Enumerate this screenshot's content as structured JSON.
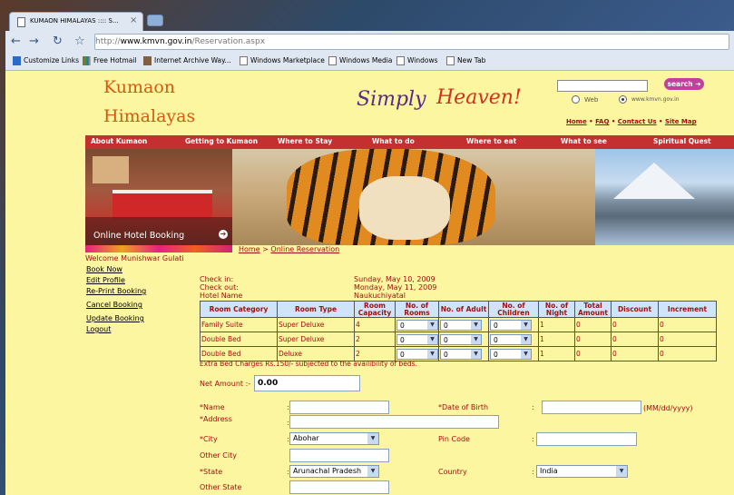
{
  "browser": {
    "tab_title": "KUMAON HIMALAYAS :::: S...",
    "tab_close": "×",
    "url_prefix": "http://",
    "url_domain": "www.kmvn.gov.in",
    "url_path": "/Reservation.aspx",
    "bookmarks": [
      "Customize Links",
      "Free Hotmail",
      "Internet Archive Way...",
      "Windows Marketplace",
      "Windows Media",
      "Windows",
      "New Tab"
    ]
  },
  "header": {
    "logo_line1": "Kumaon",
    "logo_line2": "Himalayas",
    "tagline_part1": "Simply",
    "tagline_part2": "Heaven!",
    "search_button": "search",
    "radio_web": "Web",
    "radio_site": "www.kmvn.gov.in",
    "links": [
      "Home",
      "FAQ",
      "Contact Us",
      "Site Map"
    ],
    "link_sep": " • "
  },
  "menu": [
    "About Kumaon",
    "Getting to Kumaon",
    "Where to Stay",
    "What to do",
    "Where to eat",
    "What to see",
    "Spiritual Quest"
  ],
  "banner": {
    "hotel_caption": "Online Hotel Booking",
    "arrow": "➔"
  },
  "breadcrumb": {
    "home": "Home",
    "sep": " > ",
    "current": "Online Reservation"
  },
  "sidebar": {
    "welcome": "Welcome Munishwar Gulati",
    "links": [
      "Book Now",
      "Edit Profile",
      "Re-Print Booking",
      "Cancel Booking",
      "Update Booking",
      "Logout"
    ]
  },
  "booking": {
    "checkin_label": "Check in:",
    "checkin_value": "Sunday, May 10, 2009",
    "checkout_label": "Check out:",
    "checkout_value": "Monday, May 11, 2009",
    "hotel_label": "Hotel Name",
    "hotel_value": "Naukuchiyatal"
  },
  "rooms": {
    "headers": [
      "Room Category",
      "Room Type",
      "Room Capacity",
      "No. of Rooms",
      "No. of Adult",
      "No. of Children",
      "No. of Night",
      "Total Amount",
      "Discount",
      "Increment"
    ],
    "rows": [
      {
        "category": "Family Suite",
        "type": "Super Deluxe",
        "capacity": "4",
        "rooms": "0",
        "adult": "0",
        "children": "0",
        "night": "1",
        "total": "0",
        "discount": "0",
        "increment": "0"
      },
      {
        "category": "Double Bed",
        "type": "Super Deluxe",
        "capacity": "2",
        "rooms": "0",
        "adult": "0",
        "children": "0",
        "night": "1",
        "total": "0",
        "discount": "0",
        "increment": "0"
      },
      {
        "category": "Double Bed",
        "type": "Deluxe",
        "capacity": "2",
        "rooms": "0",
        "adult": "0",
        "children": "0",
        "night": "1",
        "total": "0",
        "discount": "0",
        "increment": "0"
      }
    ],
    "extra_note": "Extra Bed Charges Rs.150/- subjected to the availibility of beds."
  },
  "form": {
    "net_amount_label": "Net Amount :-",
    "net_amount_value": "0.00",
    "colon": ":",
    "name_label": "*Name",
    "dob_label": "*Date of Birth",
    "dob_hint": "(MM/dd/yyyy)",
    "address_label": "*Address",
    "city_label": "*City",
    "city_value": "Abohar",
    "pincode_label": "Pin Code",
    "other_city_label": "Other City",
    "state_label": "*State",
    "state_value": "Arunachal Pradesh",
    "country_label": "Country",
    "country_value": "India",
    "other_state_label": "Other State"
  }
}
